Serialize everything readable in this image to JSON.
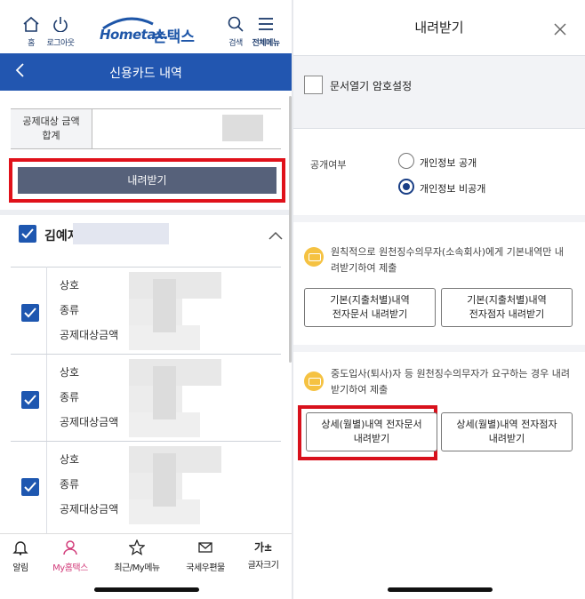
{
  "left": {
    "topbar": {
      "home_label": "홈",
      "logout_label": "로그아웃",
      "logo_part1": "Hometax.",
      "logo_part2": "손택스",
      "search_label": "검색",
      "menu_label": "전체메뉴"
    },
    "nav": {
      "title": "신용카드 내역"
    },
    "amount_label_line1": "공제대상 금액",
    "amount_label_line2": "합계",
    "download_button": "내려받기",
    "person_name": "김예지",
    "records": [
      {
        "f1": "상호",
        "f2": "종류",
        "f3": "공제대상금액",
        "checked": true
      },
      {
        "f1": "상호",
        "f2": "종류",
        "f3": "공제대상금액",
        "checked": true
      },
      {
        "f1": "상호",
        "f2": "종류",
        "f3": "공제대상금액",
        "checked": true
      }
    ],
    "bottom_nav": [
      {
        "label": "알림",
        "icon": "bell-icon"
      },
      {
        "label": "My홈택스",
        "icon": "person-icon",
        "active": true
      },
      {
        "label": "최근/My메뉴",
        "icon": "star-icon"
      },
      {
        "label": "국세우편물",
        "icon": "mail-icon"
      },
      {
        "label": "글자크기",
        "icon": "text-size-icon",
        "glyph": "가±"
      }
    ]
  },
  "right": {
    "title": "내려받기",
    "password_checkbox_label": "문서열기 암호설정",
    "password_checked": false,
    "disclosure_label": "공개여부",
    "radio_public": "개인정보 공개",
    "radio_private": "개인정보 비공개",
    "selected": "개인정보 비공개",
    "note1_line1": "원칙적으로 원천징수의무자(소속회사)에게 기본내역만 내",
    "note1_line2": "려받기하여 제출",
    "btn_basic_doc_l1": "기본(지출처별)내역",
    "btn_basic_doc_l2": "전자문서 내려받기",
    "btn_basic_sig_l1": "기본(지출처별)내역",
    "btn_basic_sig_l2": "전자점자 내려받기",
    "note2_line1": "중도입사(퇴사)자 등 원천징수의무자가 요구하는 경우 내려",
    "note2_line2": "받기하여 제출",
    "btn_detail_doc_l1": "상세(월별)내역 전자문서",
    "btn_detail_doc_l2": "내려받기",
    "btn_detail_sig_l1": "상세(월별)내역 전자점자",
    "btn_detail_sig_l2": "내려받기"
  },
  "colors": {
    "brand_blue": "#2256b0",
    "highlight_red": "#e0111a",
    "download_button_bg": "#56617a",
    "active_nav_pink": "#d23c7a"
  }
}
